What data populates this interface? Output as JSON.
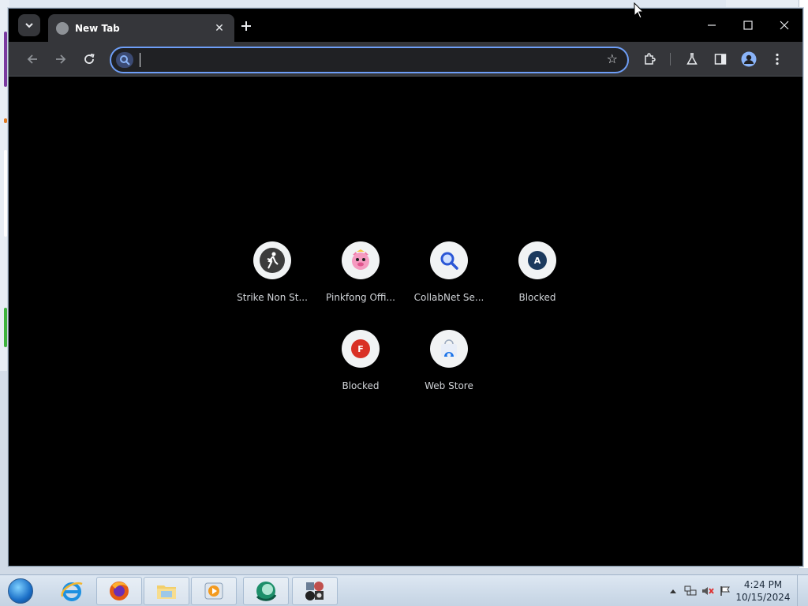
{
  "browser": {
    "tab": {
      "title": "New Tab"
    },
    "omnibox": {
      "value": "",
      "placeholder": ""
    },
    "shortcuts": [
      {
        "label": "Strike Non St...",
        "icon": "strike-icon"
      },
      {
        "label": "Pinkfong Offi...",
        "icon": "pinkfong-icon"
      },
      {
        "label": "CollabNet Se...",
        "icon": "magnifier-icon"
      },
      {
        "label": "Blocked",
        "badge": "A",
        "badge_color": "#1c3a5e"
      },
      {
        "label": "Blocked",
        "badge": "F",
        "badge_color": "#d93025"
      },
      {
        "label": "Web Store",
        "icon": "webstore-icon"
      }
    ]
  },
  "taskbar": {
    "clock": {
      "time": "4:24 PM",
      "date": "10/15/2024"
    }
  },
  "colors": {
    "accent": "#6e9ef7",
    "toolbar": "#35363a",
    "content_bg": "#000000"
  }
}
